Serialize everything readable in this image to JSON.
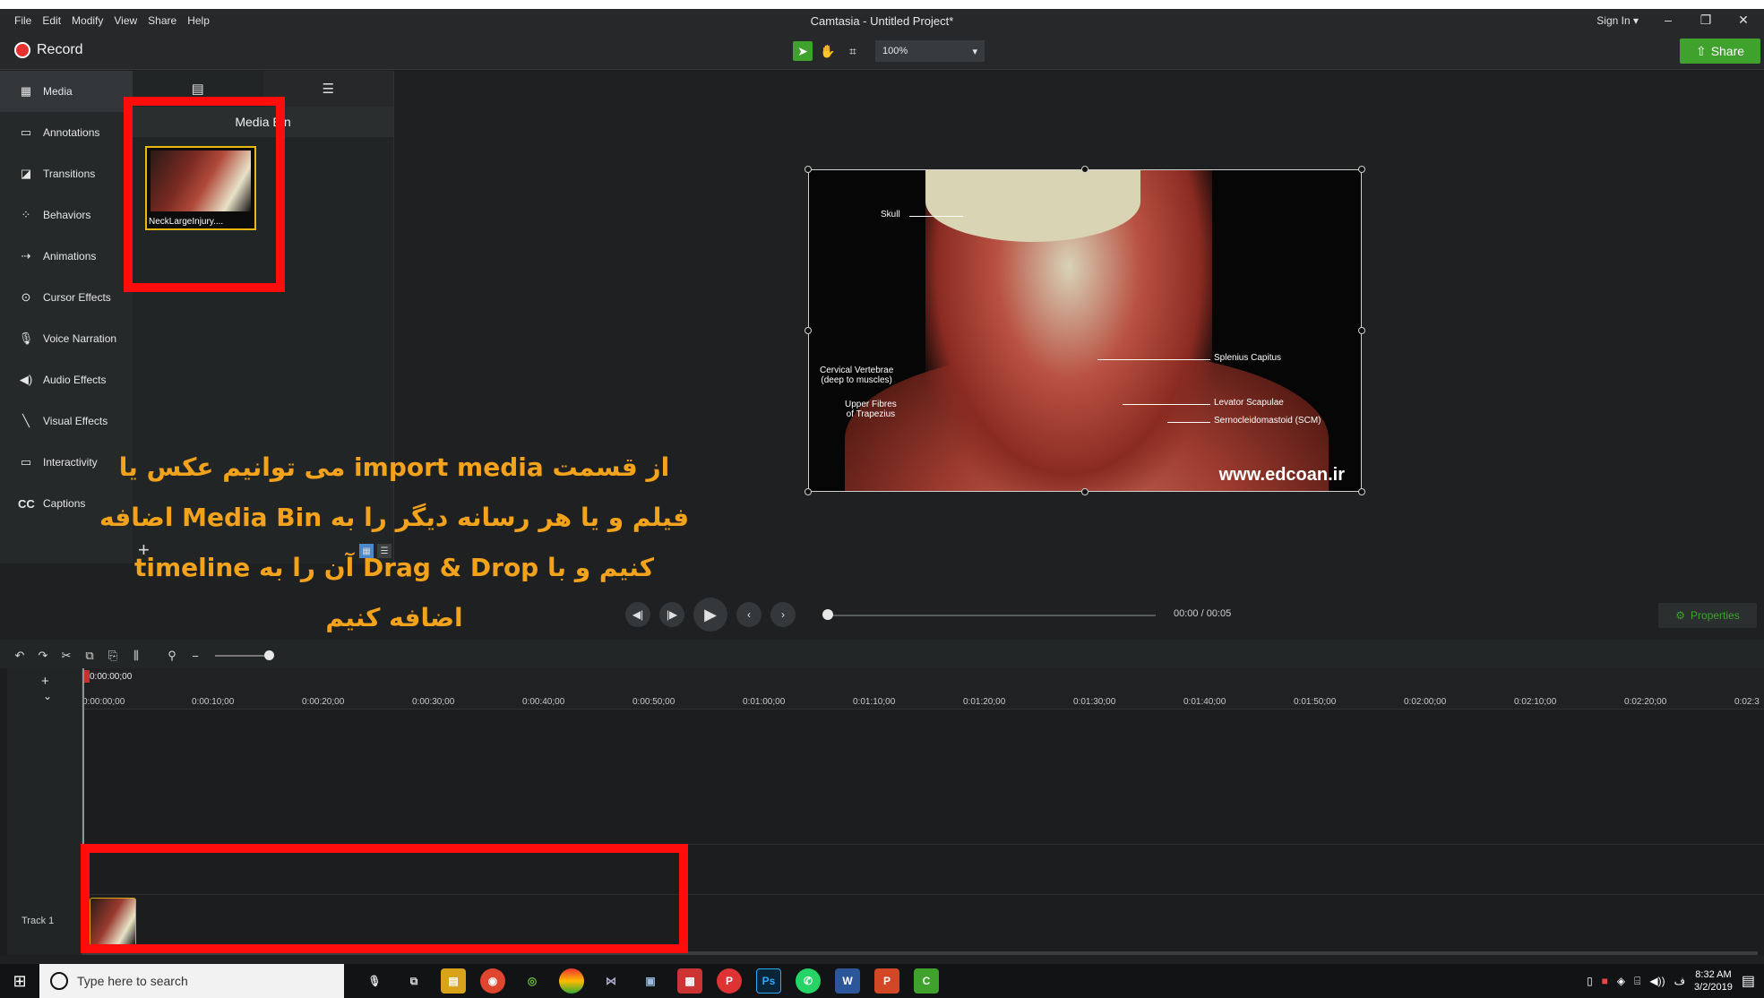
{
  "window": {
    "title": "Camtasia - Untitled Project*",
    "menus": [
      "File",
      "Edit",
      "Modify",
      "View",
      "Share",
      "Help"
    ],
    "sign_in": "Sign In ▾"
  },
  "toolbar": {
    "record_label": "Record",
    "zoom_value": "100%",
    "share_label": "Share"
  },
  "tools_panel": {
    "items": [
      {
        "label": "Media",
        "icon": "media-icon"
      },
      {
        "label": "Annotations",
        "icon": "annotations-icon"
      },
      {
        "label": "Transitions",
        "icon": "transitions-icon"
      },
      {
        "label": "Behaviors",
        "icon": "behaviors-icon"
      },
      {
        "label": "Animations",
        "icon": "animations-icon"
      },
      {
        "label": "Cursor Effects",
        "icon": "cursor-icon"
      },
      {
        "label": "Voice Narration",
        "icon": "microphone-icon"
      },
      {
        "label": "Audio Effects",
        "icon": "speaker-icon"
      },
      {
        "label": "Visual Effects",
        "icon": "wand-icon"
      },
      {
        "label": "Interactivity",
        "icon": "interactivity-icon"
      },
      {
        "label": "Captions",
        "icon": "cc-icon"
      }
    ]
  },
  "media_bin": {
    "title": "Media Bin",
    "item_name": "NeckLargeInjury...."
  },
  "preview": {
    "labels": {
      "skull": "Skull",
      "cervical": "Cervical Vertebrae\n(deep to muscles)",
      "trapezius": "Upper Fibres\nof Trapezius",
      "splenius": "Splenius Capitus",
      "levator": "Levator Scapulae",
      "scm": "Sernocleidomastoid (SCM)"
    },
    "watermark": "www.edcoan.ir"
  },
  "playback": {
    "timecode": "00:00 / 00:05",
    "properties_label": "Properties"
  },
  "timeline": {
    "playhead_time": "0:00:00;00",
    "ticks": [
      "0:00:00;00",
      "0:00:10;00",
      "0:00:20;00",
      "0:00:30;00",
      "0:00:40;00",
      "0:00:50;00",
      "0:01:00;00",
      "0:01:10;00",
      "0:01:20;00",
      "0:01:30;00",
      "0:01:40;00",
      "0:01:50;00",
      "0:02:00;00",
      "0:02:10;00",
      "0:02:20;00",
      "0:02:3"
    ],
    "track_label": "Track 1"
  },
  "overlay_text": {
    "line1": "از قسمت import media می توانیم عکس یا",
    "line2": "فیلم و یا هر رسانه دیگر را به Media Bin اضافه",
    "line3": "کنیم و با Drag & Drop آن را به timeline",
    "line4": "اضافه کنیم"
  },
  "taskbar": {
    "search_placeholder": "Type here to search",
    "time": "8:32 AM",
    "date": "3/2/2019"
  },
  "colors": {
    "accent_green": "#3fa22c",
    "highlight_red": "#ff0c0c",
    "overlay_text": "#f3a21b"
  }
}
